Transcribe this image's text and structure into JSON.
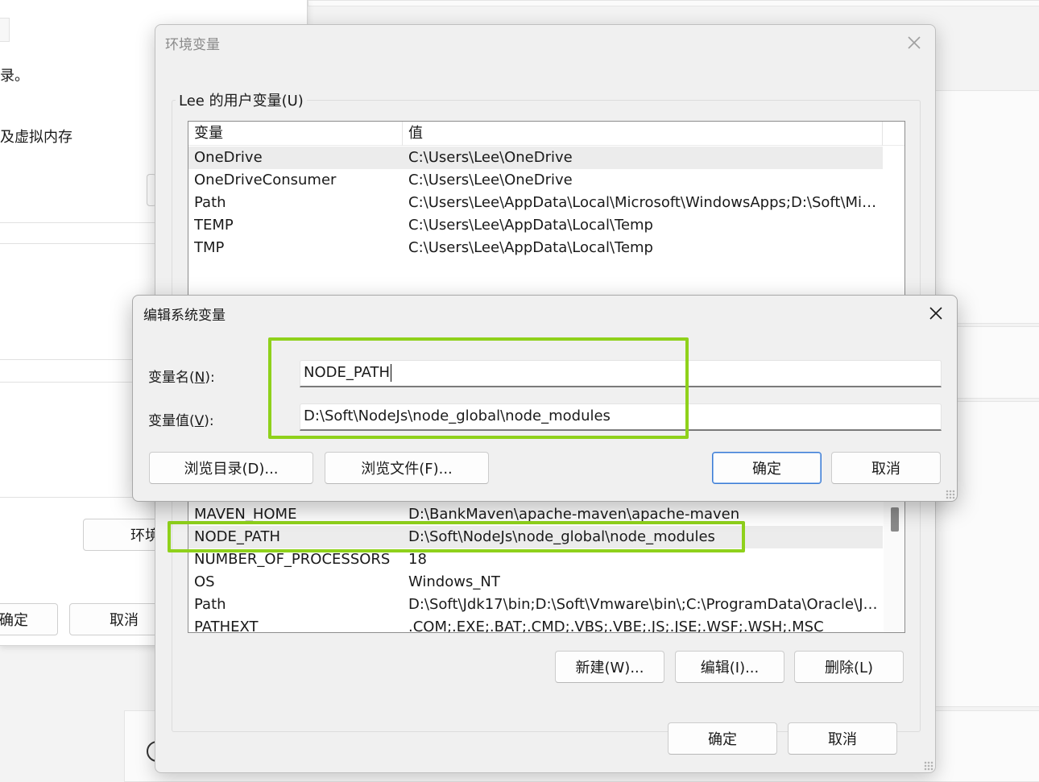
{
  "background_window": {
    "text_line1": "录。",
    "text_line2": "及虚拟内存",
    "env_button_label": "环境",
    "ok_label": "确定",
    "cancel_label": "取消"
  },
  "env_dialog": {
    "title": "环境变量",
    "user_group_label": "Lee 的用户变量(U)",
    "columns": [
      "变量",
      "值"
    ],
    "user_vars": [
      {
        "name": "OneDrive",
        "value": "C:\\Users\\Lee\\OneDrive"
      },
      {
        "name": "OneDriveConsumer",
        "value": "C:\\Users\\Lee\\OneDrive"
      },
      {
        "name": "Path",
        "value": "C:\\Users\\Lee\\AppData\\Local\\Microsoft\\WindowsApps;D:\\Soft\\Micr..."
      },
      {
        "name": "TEMP",
        "value": "C:\\Users\\Lee\\AppData\\Local\\Temp"
      },
      {
        "name": "TMP",
        "value": "C:\\Users\\Lee\\AppData\\Local\\Temp"
      }
    ],
    "system_vars": [
      {
        "name": "MAVEN_HOME",
        "value": "D:\\BankMaven\\apache-maven\\apache-maven"
      },
      {
        "name": "NODE_PATH",
        "value": "D:\\Soft\\NodeJs\\node_global\\node_modules"
      },
      {
        "name": "NUMBER_OF_PROCESSORS",
        "value": "18"
      },
      {
        "name": "OS",
        "value": "Windows_NT"
      },
      {
        "name": "Path",
        "value": "D:\\Soft\\Jdk17\\bin;D:\\Soft\\Vmware\\bin\\;C:\\ProgramData\\Oracle\\Ja..."
      },
      {
        "name": "PATHEXT",
        "value": ".COM;.EXE;.BAT;.CMD;.VBS;.VBE;.JS;.JSE;.WSF;.WSH;.MSC"
      }
    ],
    "new_label": "新建(W)...",
    "edit_label": "编辑(I)...",
    "delete_label": "删除(L)",
    "ok_label": "确定",
    "cancel_label": "取消"
  },
  "edit_dialog": {
    "title": "编辑系统变量",
    "name_label": "变量名(",
    "name_key": "N",
    "name_label_end": "):",
    "value_label": "变量值(",
    "value_key": "V",
    "value_label_end": "):",
    "name_value": "NODE_PATH",
    "value_value": "D:\\Soft\\NodeJs\\node_global\\node_modules",
    "browse_dir_label": "浏览目录(D)...",
    "browse_file_label": "浏览文件(F)...",
    "ok_label": "确定",
    "cancel_label": "取消"
  },
  "colors": {
    "highlight": "#8fd11b",
    "primary_button_border": "#3a7bd5"
  },
  "icons": [
    "close-icon",
    "resize-grip-icon"
  ]
}
